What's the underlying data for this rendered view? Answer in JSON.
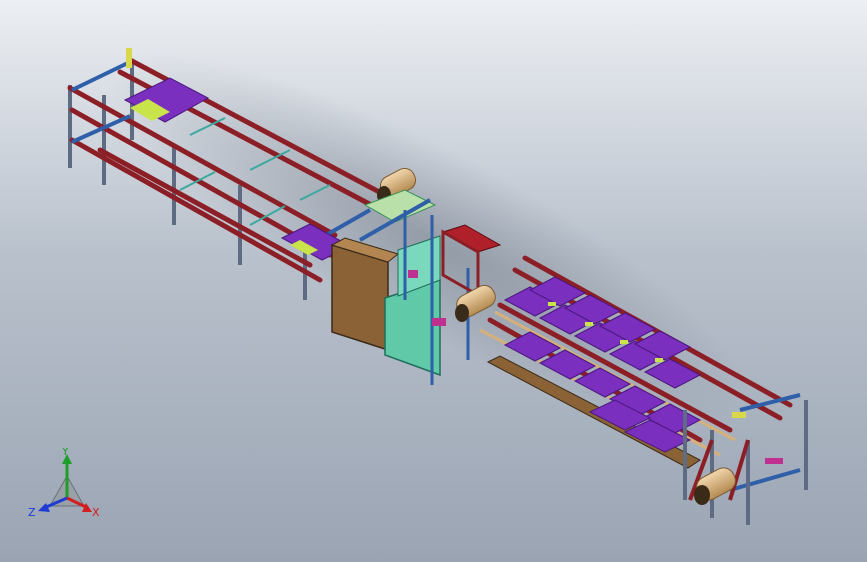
{
  "viewport": {
    "triad": {
      "x_label": "X",
      "y_label": "Y",
      "z_label": "Z"
    }
  },
  "colors": {
    "background_top": "#eceff3",
    "background_bottom": "#9aa4b3",
    "frame_red": "#8c1e26",
    "frame_blue": "#2e5fa8",
    "leg_gray": "#5f6b82",
    "tray_purple": "#7b2fbe",
    "panel_brown": "#8a6236",
    "panel_teal": "#5fc9a8",
    "roller_tan": "#d6b07a",
    "axis_red": "#d21e1e",
    "axis_green": "#1ea028",
    "axis_blue": "#1e3cd2"
  },
  "icons": {
    "coordinate_triad": "xyz-triad-icon"
  }
}
